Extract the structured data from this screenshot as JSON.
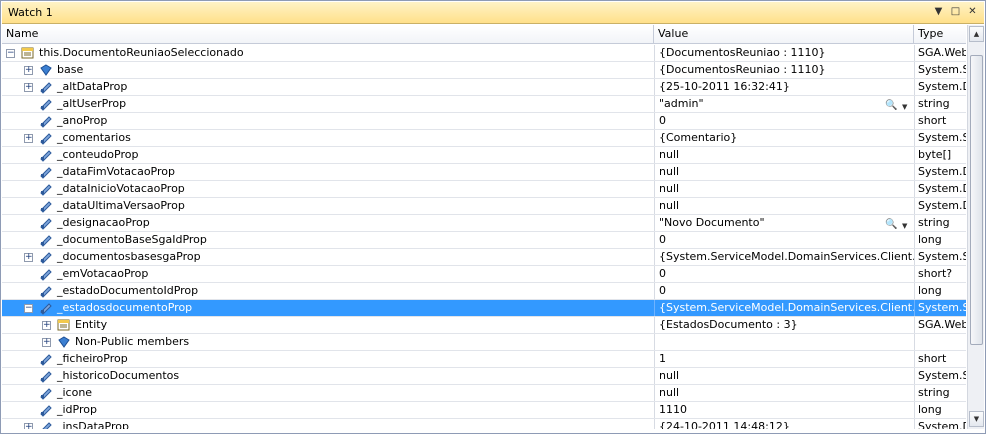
{
  "window": {
    "title": "Watch 1",
    "menu_arrow": "▼",
    "restore": "□",
    "close": "✕"
  },
  "columns": {
    "name": "Name",
    "value": "Value",
    "type": "Type"
  },
  "rows": [
    {
      "name": "this.DocumentoReuniaoSeleccionado",
      "value": "{DocumentosReuniao : 1110}",
      "type": "SGA.Web",
      "level": 0,
      "exp": "−",
      "icon": "object-icon"
    },
    {
      "name": "base",
      "value": "{DocumentosReuniao : 1110}",
      "type": "System.S",
      "level": 1,
      "exp": "+",
      "icon": "base-icon"
    },
    {
      "name": "_altDataProp",
      "value": "{25-10-2011 16:32:41}",
      "type": "System.D",
      "level": 1,
      "exp": "+",
      "icon": "field-icon"
    },
    {
      "name": "_altUserProp",
      "value": "\"admin\"",
      "type": "string",
      "level": 1,
      "exp": "",
      "icon": "field-icon",
      "mag": true
    },
    {
      "name": "_anoProp",
      "value": "0",
      "type": "short",
      "level": 1,
      "exp": "",
      "icon": "field-icon"
    },
    {
      "name": "_comentarios",
      "value": "{Comentario}",
      "type": "System.S",
      "level": 1,
      "exp": "+",
      "icon": "field-icon"
    },
    {
      "name": "_conteudoProp",
      "value": "null",
      "type": "byte[]",
      "level": 1,
      "exp": "",
      "icon": "field-icon"
    },
    {
      "name": "_dataFimVotacaoProp",
      "value": "null",
      "type": "System.D",
      "level": 1,
      "exp": "",
      "icon": "field-icon"
    },
    {
      "name": "_dataInicioVotacaoProp",
      "value": "null",
      "type": "System.D",
      "level": 1,
      "exp": "",
      "icon": "field-icon"
    },
    {
      "name": "_dataUltimaVersaoProp",
      "value": "null",
      "type": "System.D",
      "level": 1,
      "exp": "",
      "icon": "field-icon"
    },
    {
      "name": "_designacaoProp",
      "value": "\"Novo Documento\"",
      "type": "string",
      "level": 1,
      "exp": "",
      "icon": "field-icon",
      "mag": true
    },
    {
      "name": "_documentoBaseSgaIdProp",
      "value": "0",
      "type": "long",
      "level": 1,
      "exp": "",
      "icon": "field-icon"
    },
    {
      "name": "_documentosbasesgaProp",
      "value": "{System.ServiceModel.DomainServices.Client.En",
      "type": "System.S",
      "level": 1,
      "exp": "+",
      "icon": "field-icon"
    },
    {
      "name": "_emVotacaoProp",
      "value": "0",
      "type": "short?",
      "level": 1,
      "exp": "",
      "icon": "field-icon"
    },
    {
      "name": "_estadoDocumentoIdProp",
      "value": "0",
      "type": "long",
      "level": 1,
      "exp": "",
      "icon": "field-icon"
    },
    {
      "name": "_estadosdocumentoProp",
      "value": "{System.ServiceModel.DomainServices.Client.En",
      "type": "System.S",
      "level": 1,
      "exp": "−",
      "icon": "field-icon",
      "selected": true
    },
    {
      "name": "Entity",
      "value": "{EstadosDocumento : 3}",
      "type": "SGA.Web",
      "level": 2,
      "exp": "+",
      "icon": "object-icon"
    },
    {
      "name": "Non-Public members",
      "value": "",
      "type": "",
      "level": 2,
      "exp": "+",
      "icon": "base-icon"
    },
    {
      "name": "_ficheiroProp",
      "value": "1",
      "type": "short",
      "level": 1,
      "exp": "",
      "icon": "field-icon"
    },
    {
      "name": "_historicoDocumentos",
      "value": "null",
      "type": "System.S",
      "level": 1,
      "exp": "",
      "icon": "field-icon"
    },
    {
      "name": "_icone",
      "value": "null",
      "type": "string",
      "level": 1,
      "exp": "",
      "icon": "field-icon"
    },
    {
      "name": "_idProp",
      "value": "1110",
      "type": "long",
      "level": 1,
      "exp": "",
      "icon": "field-icon"
    },
    {
      "name": "_insDataProp",
      "value": "{24-10-2011 14:48:12}",
      "type": "System.D",
      "level": 1,
      "exp": "+",
      "icon": "field-icon"
    }
  ],
  "scroll": {
    "up": "▲",
    "down": "▼"
  },
  "search_glyph": "🔍",
  "dropdown_glyph": "▼",
  "colors": {
    "selection": "#3399ff",
    "title_bar": "#ffe08a"
  }
}
